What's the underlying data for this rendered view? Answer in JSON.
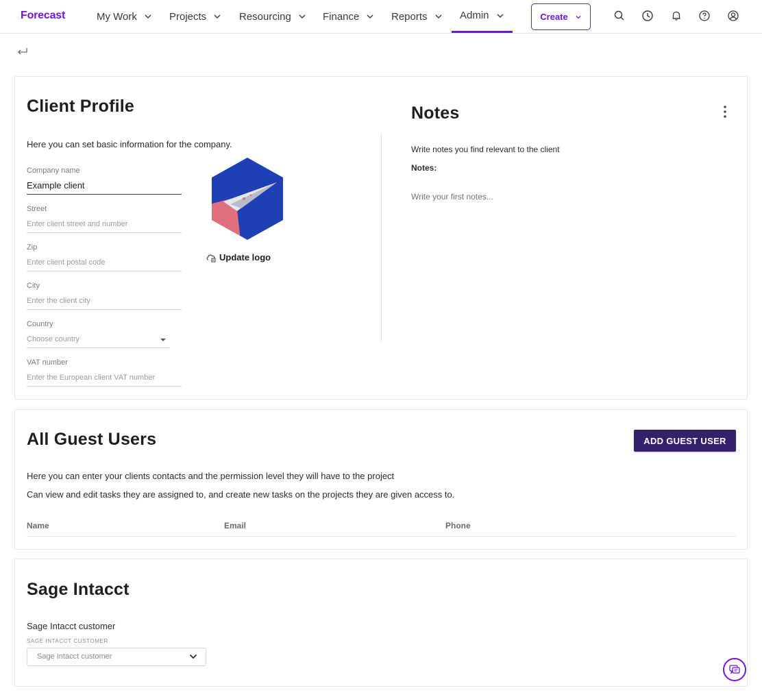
{
  "nav": {
    "logo": "Forecast",
    "items": [
      {
        "label": "My Work"
      },
      {
        "label": "Projects"
      },
      {
        "label": "Resourcing"
      },
      {
        "label": "Finance"
      },
      {
        "label": "Reports"
      },
      {
        "label": "Admin",
        "active": true
      }
    ],
    "create_label": "Create",
    "icons": [
      "search-icon",
      "clock-icon",
      "bell-icon",
      "help-icon",
      "profile-icon"
    ],
    "accent_color": "#6e17d4"
  },
  "client_profile": {
    "title": "Client Profile",
    "description": "Here you can set basic information for the company.",
    "fields": {
      "company_name": {
        "label": "Company name",
        "value": "Example client"
      },
      "street": {
        "label": "Street",
        "placeholder": "Enter client street and number"
      },
      "zip": {
        "label": "Zip",
        "placeholder": "Enter client postal code"
      },
      "city": {
        "label": "City",
        "placeholder": "Enter the client city"
      },
      "country": {
        "label": "Country",
        "placeholder": "Choose country"
      },
      "vat": {
        "label": "VAT number",
        "placeholder": "Enter the European client VAT number"
      }
    },
    "update_logo_label": "Update logo"
  },
  "notes": {
    "title": "Notes",
    "description": "Write notes you find relevant to the client",
    "label": "Notes:",
    "placeholder": "Write your first notes..."
  },
  "guest_users": {
    "title": "All Guest Users",
    "add_button": "ADD GUEST USER",
    "description_1": "Here you can enter your clients contacts and the permission level they will have to the project",
    "description_2": "Can view and edit tasks they are assigned to, and create new tasks on the projects they are given access to.",
    "columns": [
      "Name",
      "Email",
      "Phone"
    ],
    "button_color": "#35206b"
  },
  "sage": {
    "title": "Sage Intacct",
    "label": "Sage Intacct customer",
    "caps_label": "SAGE INTACCT CUSTOMER",
    "select_placeholder": "Sage Intacct customer"
  }
}
